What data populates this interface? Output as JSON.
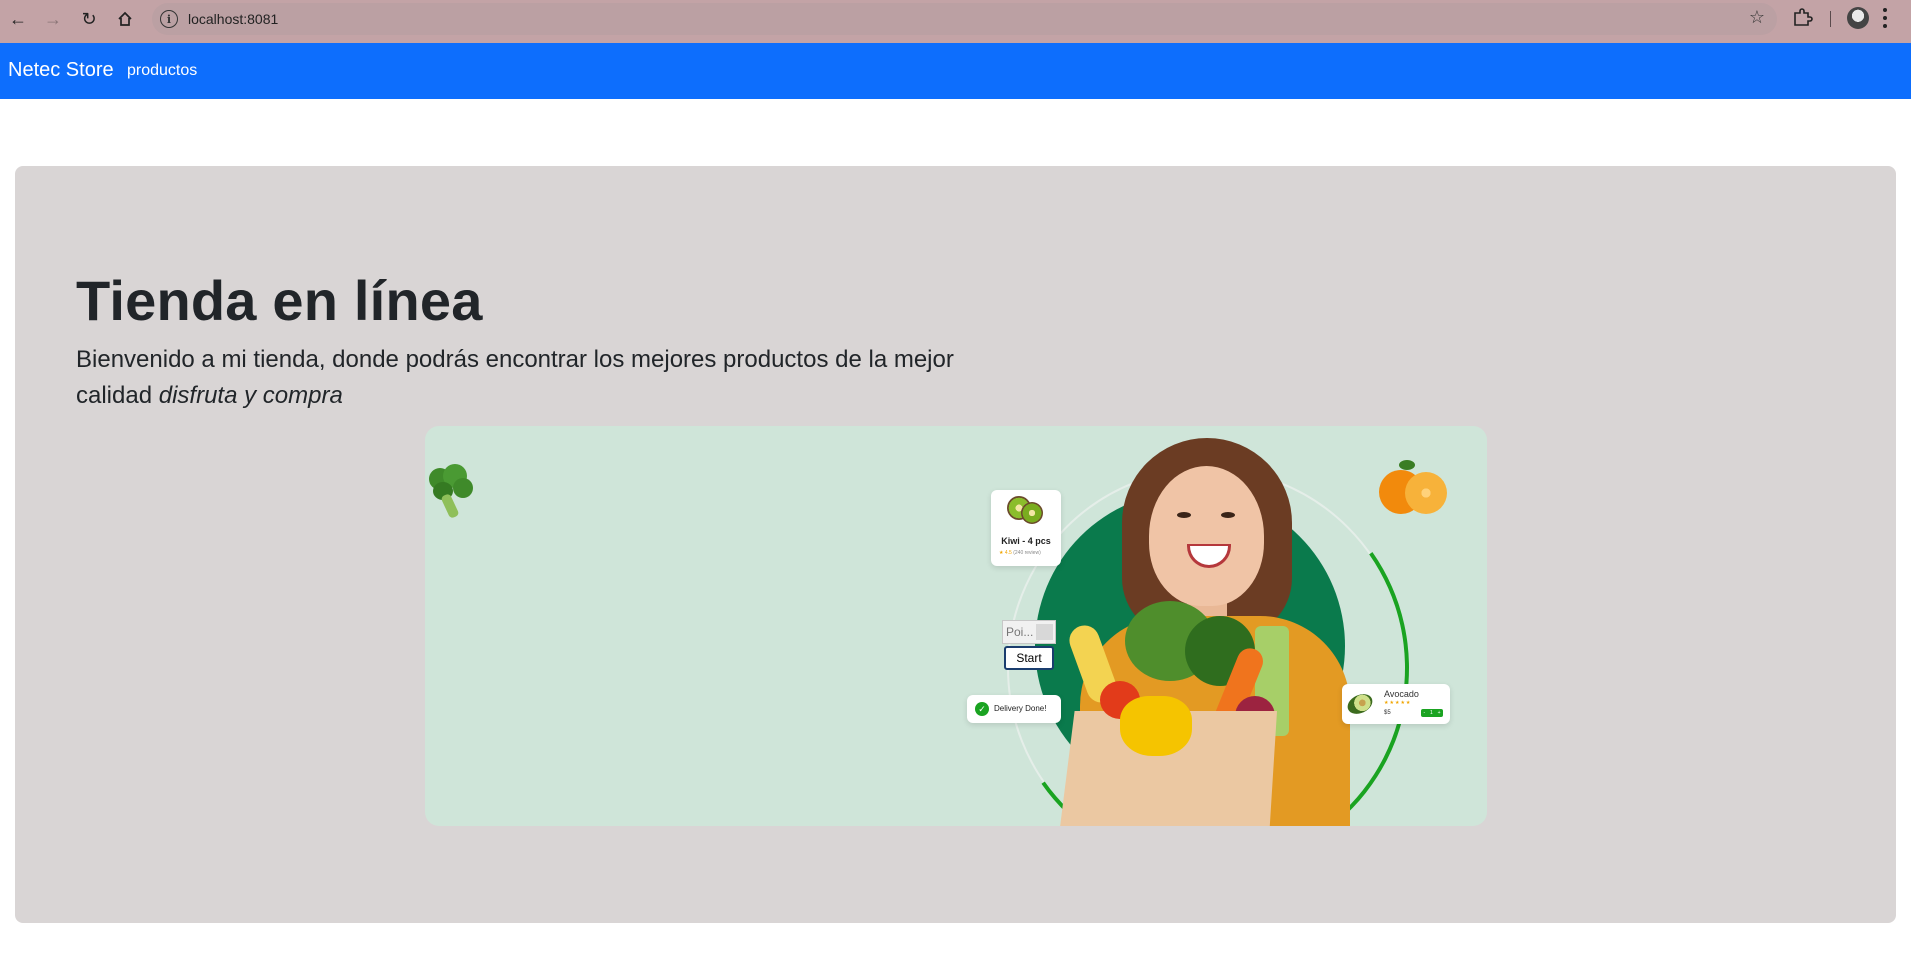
{
  "browser": {
    "url": "localhost:8081",
    "icons": [
      "back-arrow-icon",
      "forward-arrow-icon",
      "reload-icon",
      "home-icon",
      "site-info-icon",
      "bookmark-star-icon",
      "extensions-icon",
      "profile-avatar",
      "kebab-menu-icon"
    ]
  },
  "navbar": {
    "brand": "Netec Store",
    "link": "productos",
    "color": "#0d6efd"
  },
  "hero": {
    "title": "Tienda en línea",
    "lead_text": "Bienvenido a mi tienda, donde podrás encontrar los mejores productos de la mejor calidad ",
    "lead_emphasis": "disfruta y compra",
    "background": "#d9d5d5"
  },
  "banner": {
    "background": "#cfe5d9",
    "kiwi_card": {
      "title": "Kiwi - 4 pcs",
      "rating": "★ 4.5",
      "reviews": "(240 review)"
    },
    "delivery_card": {
      "text": "Delivery Done!"
    },
    "avocado_card": {
      "name": "Avocado",
      "stars": "★★★★★",
      "price": "$5",
      "stepper_minus": "-",
      "stepper_value": "1",
      "stepper_plus": "+"
    },
    "widget": {
      "input_value": "Poi...",
      "start_label": "Start"
    }
  }
}
